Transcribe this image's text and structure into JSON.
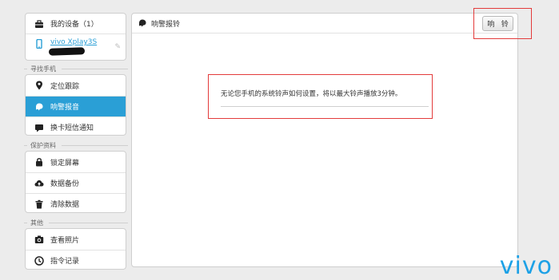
{
  "device_panel": {
    "title": "我的设备（1）",
    "device_name": "vivo Xplay3S"
  },
  "sections": {
    "find_phone": {
      "label": "寻找手机",
      "items": [
        {
          "label": "定位跟踪",
          "icon": "location-pin-icon"
        },
        {
          "label": "响警报音",
          "icon": "alarm-sound-icon",
          "active": true
        },
        {
          "label": "换卡短信通知",
          "icon": "message-icon"
        }
      ]
    },
    "protect_data": {
      "label": "保护资料",
      "items": [
        {
          "label": "锁定屏幕",
          "icon": "lock-icon"
        },
        {
          "label": "数据备份",
          "icon": "cloud-upload-icon"
        },
        {
          "label": "清除数据",
          "icon": "trash-icon"
        }
      ]
    },
    "other": {
      "label": "其他",
      "items": [
        {
          "label": "查看照片",
          "icon": "camera-icon"
        },
        {
          "label": "指令记录",
          "icon": "clock-icon"
        }
      ]
    }
  },
  "main": {
    "title": "响警报铃",
    "ring_button": "响 铃",
    "message": "无论您手机的系统铃声如何设置，将以最大铃声播放3分钟。"
  },
  "brand": {
    "logo_text": "vivo",
    "accent_color": "#2a9fd6",
    "highlight_color": "#e33b3b"
  }
}
